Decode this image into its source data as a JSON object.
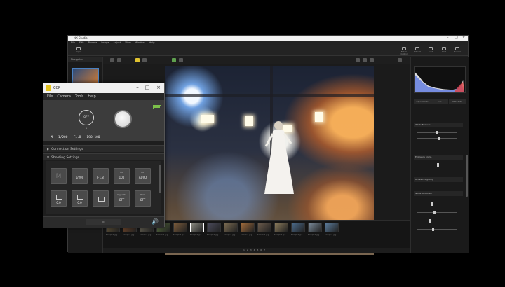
{
  "main_window": {
    "title": "NX Studio",
    "menu": [
      "File",
      "Edit",
      "Browse",
      "Image",
      "Adjust",
      "View",
      "Window",
      "Help"
    ],
    "toolbar": [
      "Import",
      "Picture Control",
      "Retouch",
      "Send",
      "Print",
      "Transfer"
    ],
    "nav_panel_title": "Navigator",
    "right_panel": {
      "tabs": [
        "Adjustments",
        "Info",
        "Metadata"
      ],
      "sections": [
        "White Balance",
        "Exposure comp.",
        "Active D-Lighting",
        "Noise Reduction"
      ]
    },
    "filmstrip": {
      "thumb_caption": "Sample1.jpg",
      "count": 14,
      "selected_index": 5,
      "colors": [
        "#6b5a3a",
        "#7a4a2a",
        "#6f6a5a",
        "#5a7040",
        "#7a5a3a",
        "#8a8a80",
        "#4a4a5a",
        "#7a6a50",
        "#a06a3a",
        "#6a5a4a",
        "#8a7a5a",
        "#4a6a8a",
        "#7a8a9a",
        "#5a7a9a"
      ]
    },
    "pager": "1 2 3 4 5 6 7"
  },
  "control_window": {
    "title": "CCP",
    "menu": [
      "File",
      "Camera",
      "Tools",
      "Help"
    ],
    "shutter_mode_label": "OFF",
    "shutter_mode_sub": "S",
    "exposure": {
      "mode": "M",
      "shutter": "1/200",
      "aperture": "F1.8",
      "iso": "ISO 100"
    },
    "sections": {
      "connection": "Connection Settings",
      "shooting": "Shooting Settings"
    },
    "shooting_buttons": [
      {
        "top": "",
        "value": "M"
      },
      {
        "top": "",
        "value": "1/200"
      },
      {
        "top": "",
        "value": "F1.8"
      },
      {
        "top": "ISO",
        "value": "100"
      },
      {
        "top": "ISO",
        "value": "AUTO"
      },
      {
        "top": "",
        "value": "0.0"
      },
      {
        "top": "",
        "value": "0.0"
      },
      {
        "top": "",
        "value": ""
      },
      {
        "top": "Vignette",
        "value": "OFF"
      },
      {
        "top": "HDR",
        "value": "OFF"
      }
    ]
  }
}
